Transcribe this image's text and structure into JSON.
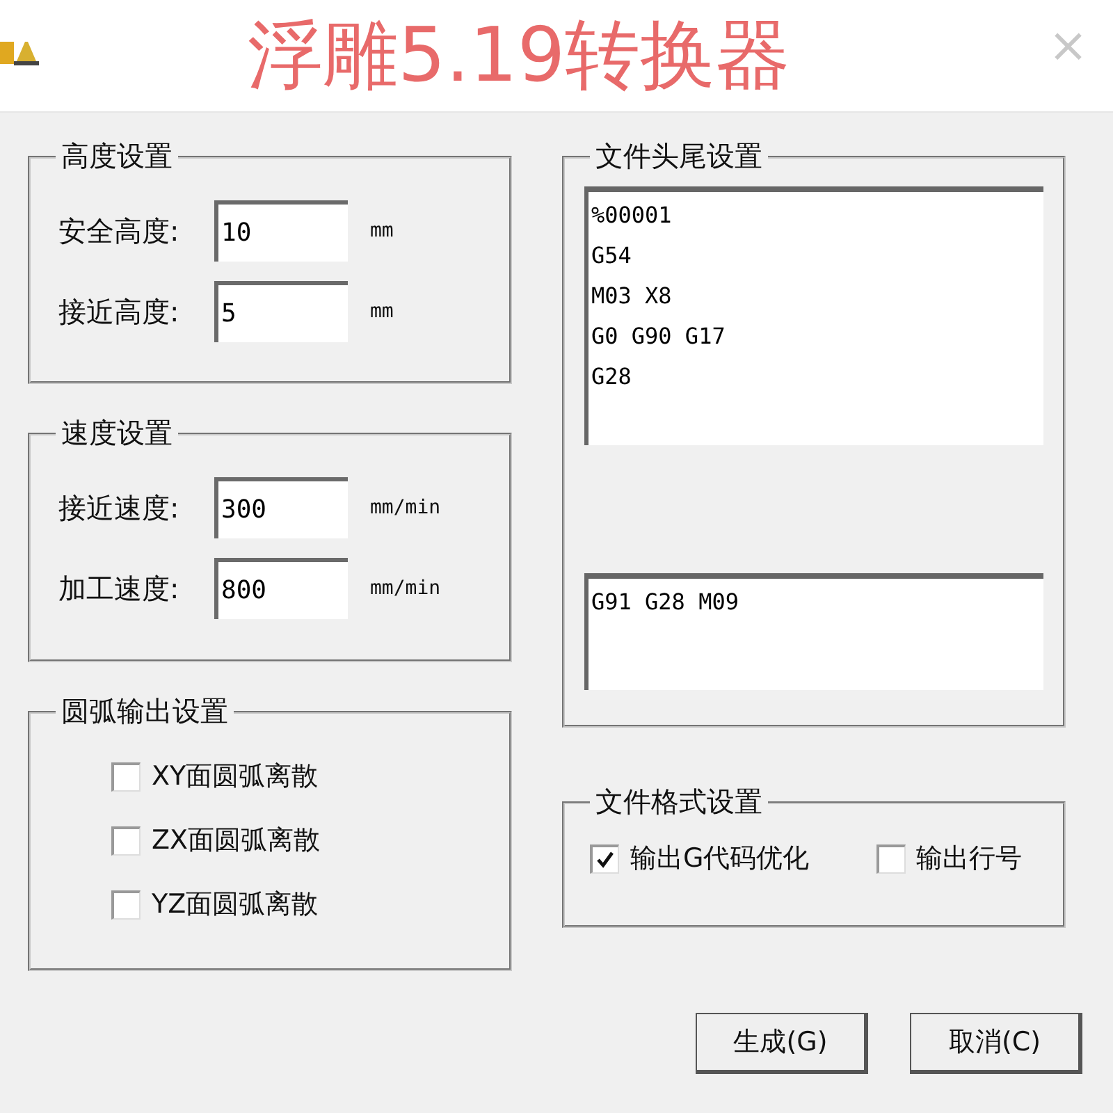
{
  "window": {
    "title": "浮雕5.19转换器",
    "close": "×"
  },
  "height_group": {
    "title": "高度设置",
    "fields": [
      {
        "label": "安全高度:",
        "value": "10",
        "unit": "mm"
      },
      {
        "label": "接近高度:",
        "value": "5",
        "unit": "mm"
      }
    ]
  },
  "speed_group": {
    "title": "速度设置",
    "fields": [
      {
        "label": "接近速度:",
        "value": "300",
        "unit": "mm/min"
      },
      {
        "label": "加工速度:",
        "value": "800",
        "unit": "mm/min"
      }
    ]
  },
  "arc_group": {
    "title": "圆弧输出设置",
    "options": [
      {
        "label": "XY面圆弧离散",
        "checked": false
      },
      {
        "label": "ZX面圆弧离散",
        "checked": false
      },
      {
        "label": "YZ面圆弧离散",
        "checked": false
      }
    ]
  },
  "file_group": {
    "title": "文件头尾设置",
    "header": "%00001\nG54\nM03 X8\nG0 G90 G17\nG28",
    "footer": "G91 G28 M09"
  },
  "format_group": {
    "title": "文件格式设置",
    "options": [
      {
        "label": "输出G代码优化",
        "checked": true
      },
      {
        "label": "输出行号",
        "checked": false
      }
    ]
  },
  "buttons": [
    "生成(G)",
    "取消(C)"
  ]
}
